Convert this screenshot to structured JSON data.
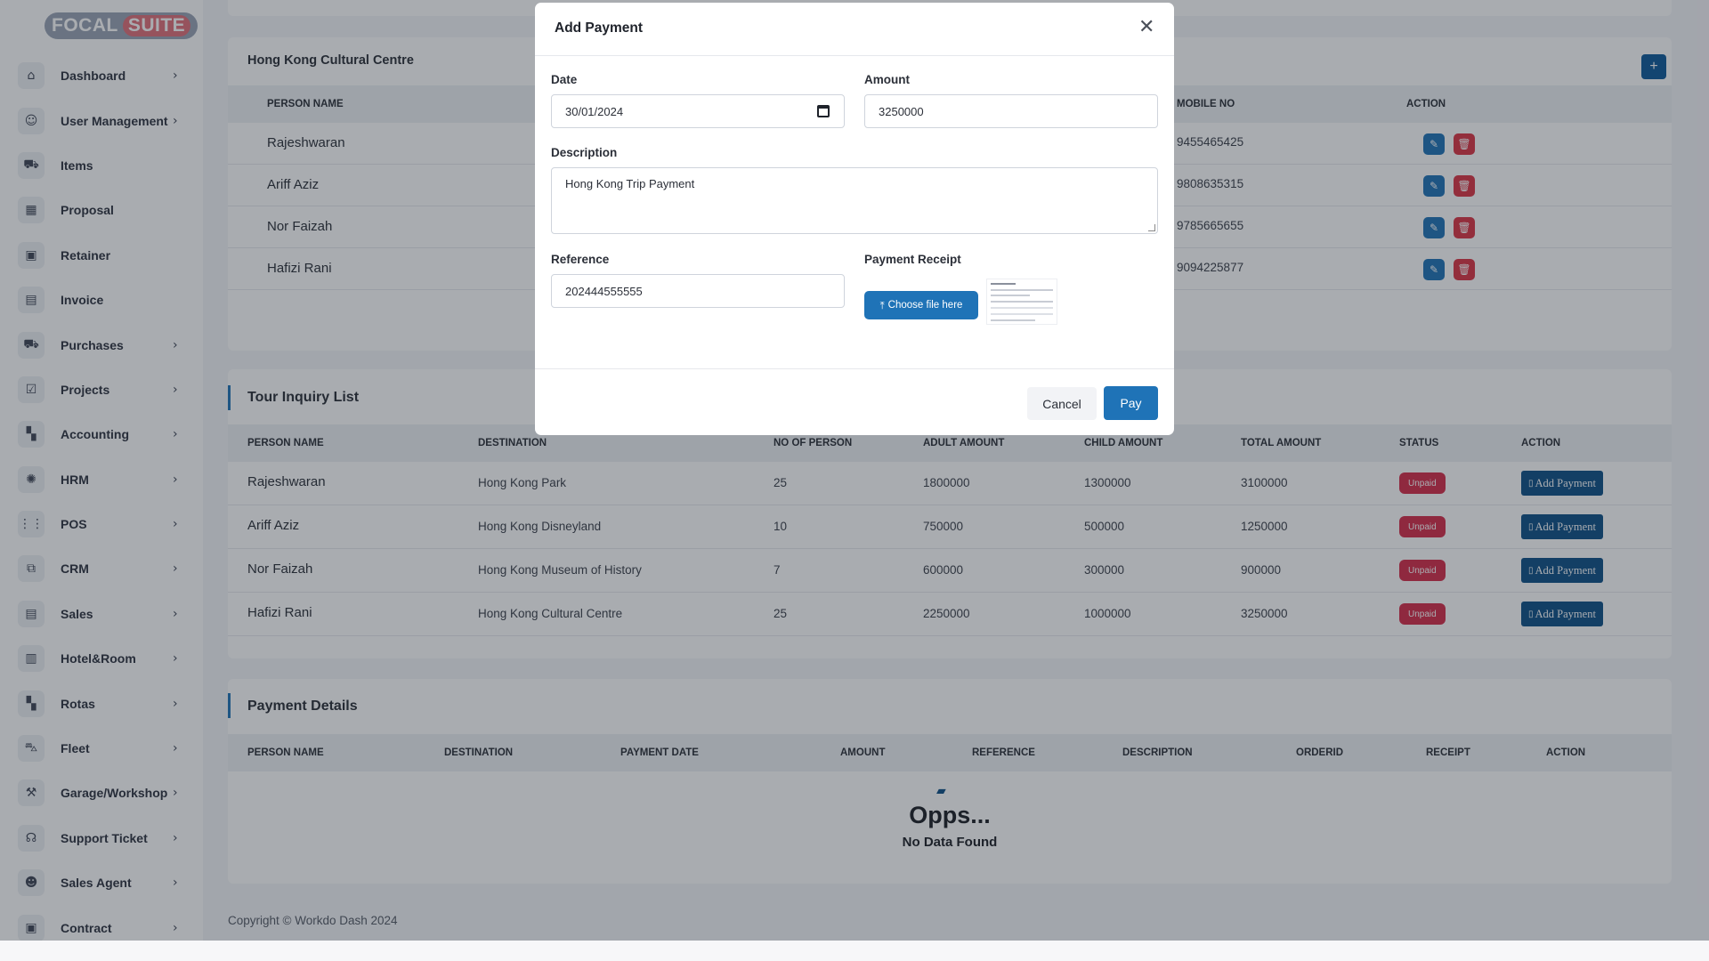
{
  "brand": {
    "part1": "FOCAL",
    "part2": "SUITE"
  },
  "sidebar": {
    "items": [
      {
        "label": "Dashboard",
        "icon": "home-icon",
        "glyph": "⌂",
        "chevron": true
      },
      {
        "label": "User Management",
        "icon": "users-icon",
        "glyph": "☺",
        "chevron": true
      },
      {
        "label": "Items",
        "icon": "cart-icon",
        "glyph": "⛟",
        "chevron": false
      },
      {
        "label": "Proposal",
        "icon": "proposal-icon",
        "glyph": "▦",
        "chevron": false
      },
      {
        "label": "Retainer",
        "icon": "retainer-icon",
        "glyph": "▣",
        "chevron": false
      },
      {
        "label": "Invoice",
        "icon": "invoice-icon",
        "glyph": "▤",
        "chevron": false
      },
      {
        "label": "Purchases",
        "icon": "purchase-cart-icon",
        "glyph": "⛟",
        "chevron": true
      },
      {
        "label": "Projects",
        "icon": "projects-icon",
        "glyph": "☑",
        "chevron": true
      },
      {
        "label": "Accounting",
        "icon": "accounting-icon",
        "glyph": "▚",
        "chevron": true
      },
      {
        "label": "HRM",
        "icon": "hrm-icon",
        "glyph": "✺",
        "chevron": true
      },
      {
        "label": "POS",
        "icon": "pos-grid-icon",
        "glyph": "⋮⋮",
        "chevron": true
      },
      {
        "label": "CRM",
        "icon": "crm-icon",
        "glyph": "⧉",
        "chevron": true
      },
      {
        "label": "Sales",
        "icon": "sales-icon",
        "glyph": "▤",
        "chevron": true
      },
      {
        "label": "Hotel&Room",
        "icon": "hotel-icon",
        "glyph": "▥",
        "chevron": true
      },
      {
        "label": "Rotas",
        "icon": "rotas-icon",
        "glyph": "▚",
        "chevron": true
      },
      {
        "label": "Fleet",
        "icon": "fleet-icon",
        "glyph": "⛍",
        "chevron": true
      },
      {
        "label": "Garage/Workshop",
        "icon": "garage-icon",
        "glyph": "⚒",
        "chevron": true
      },
      {
        "label": "Support Ticket",
        "icon": "headset-icon",
        "glyph": "☊",
        "chevron": true
      },
      {
        "label": "Sales Agent",
        "icon": "sales-agent-icon",
        "glyph": "☻",
        "chevron": true
      },
      {
        "label": "Contract",
        "icon": "contract-icon",
        "glyph": "▣",
        "chevron": true
      }
    ]
  },
  "hotel_card": {
    "title": "Hong Kong Cultural Centre",
    "headers": {
      "person": "PERSON NAME",
      "mobile": "MOBILE NO",
      "action": "ACTION"
    },
    "rows": [
      {
        "name": "Rajeshwaran",
        "mobile": "9455465425"
      },
      {
        "name": "Ariff Aziz",
        "mobile": "9808635315"
      },
      {
        "name": "Nor Faizah",
        "mobile": "9785665655"
      },
      {
        "name": "Hafizi Rani",
        "mobile": "9094225877"
      }
    ]
  },
  "tour_card": {
    "title": "Tour Inquiry List",
    "headers": [
      "PERSON NAME",
      "DESTINATION",
      "NO OF PERSON",
      "ADULT AMOUNT",
      "CHILD AMOUNT",
      "TOTAL AMOUNT",
      "STATUS",
      "ACTION"
    ],
    "rows": [
      {
        "name": "Rajeshwaran",
        "destination": "Hong Kong Park",
        "persons": "25",
        "adult": "1800000",
        "child": "1300000",
        "total": "3100000",
        "status": "Unpaid",
        "action": "Add Payment"
      },
      {
        "name": "Ariff Aziz",
        "destination": "Hong Kong Disneyland",
        "persons": "10",
        "adult": "750000",
        "child": "500000",
        "total": "1250000",
        "status": "Unpaid",
        "action": "Add Payment"
      },
      {
        "name": "Nor Faizah",
        "destination": "Hong Kong Museum of History",
        "persons": "7",
        "adult": "600000",
        "child": "300000",
        "total": "900000",
        "status": "Unpaid",
        "action": "Add Payment"
      },
      {
        "name": "Hafizi Rani",
        "destination": "Hong Kong Cultural Centre",
        "persons": "25",
        "adult": "2250000",
        "child": "1000000",
        "total": "3250000",
        "status": "Unpaid",
        "action": "Add Payment"
      }
    ]
  },
  "payment_card": {
    "title": "Payment Details",
    "headers": [
      "PERSON NAME",
      "DESTINATION",
      "PAYMENT DATE",
      "AMOUNT",
      "REFERENCE",
      "DESCRIPTION",
      "ORDERID",
      "RECEIPT",
      "ACTION"
    ],
    "empty_title": "Opps...",
    "empty_sub": "No Data Found"
  },
  "footer": {
    "copyright": "Copyright © Workdo Dash 2024"
  },
  "modal": {
    "title": "Add Payment",
    "date_label": "Date",
    "date_value": "30/01/2024",
    "amount_label": "Amount",
    "amount_value": "3250000",
    "description_label": "Description",
    "description_value": "Hong Kong Trip Payment",
    "reference_label": "Reference",
    "reference_value": "202444555555",
    "receipt_label": "Payment Receipt",
    "choose_file": "Choose file here",
    "cancel": "Cancel",
    "pay": "Pay"
  },
  "colors": {
    "primary": "#1f73b7",
    "danger": "#dc3545",
    "badge": "#d62d4a",
    "dark_button": "#0e4f86"
  }
}
